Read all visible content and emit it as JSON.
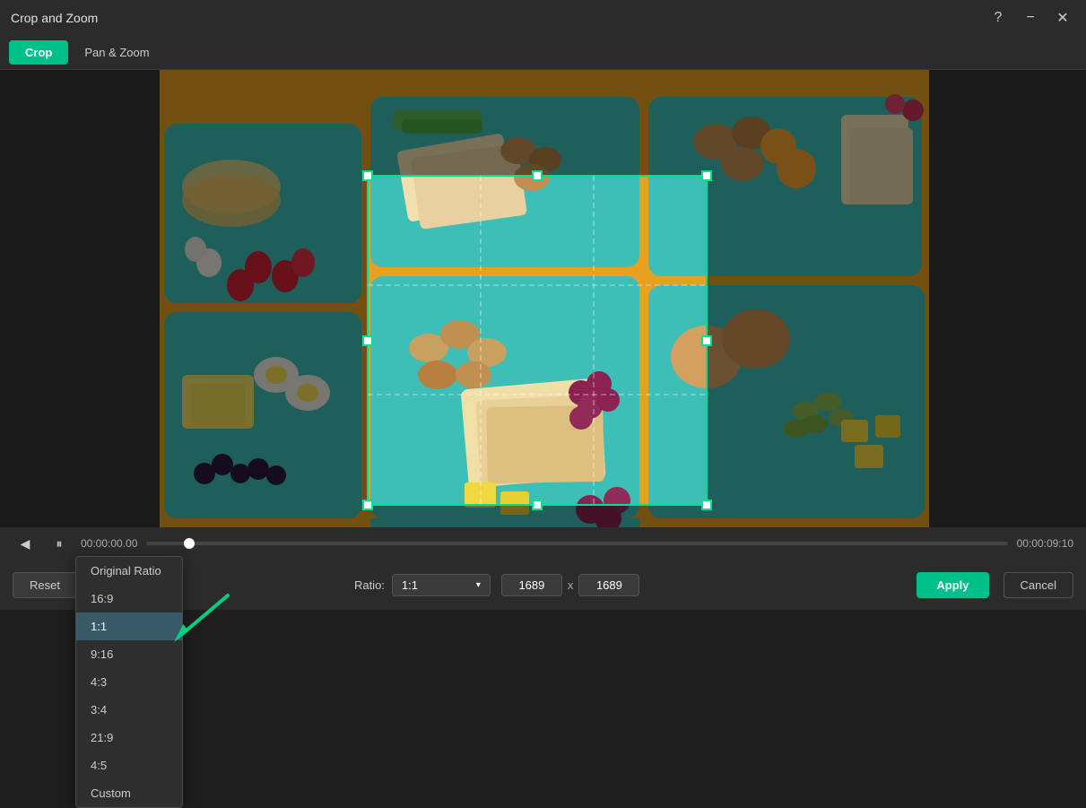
{
  "window": {
    "title": "Crop and Zoom",
    "help_icon": "?",
    "minimize_icon": "−",
    "close_icon": "✕"
  },
  "tabs": [
    {
      "id": "crop",
      "label": "Crop",
      "active": true
    },
    {
      "id": "pan-zoom",
      "label": "Pan & Zoom",
      "active": false
    }
  ],
  "dropdown": {
    "items": [
      {
        "id": "original",
        "label": "Original Ratio",
        "selected": false
      },
      {
        "id": "16:9",
        "label": "16:9",
        "selected": false
      },
      {
        "id": "1:1",
        "label": "1:1",
        "selected": true
      },
      {
        "id": "9:16",
        "label": "9:16",
        "selected": false
      },
      {
        "id": "4:3",
        "label": "4:3",
        "selected": false
      },
      {
        "id": "3:4",
        "label": "3:4",
        "selected": false
      },
      {
        "id": "21:9",
        "label": "21:9",
        "selected": false
      },
      {
        "id": "4:5",
        "label": "4:5",
        "selected": false
      },
      {
        "id": "custom",
        "label": "Custom",
        "selected": false
      }
    ]
  },
  "timeline": {
    "start_time": "00:00:00.00",
    "end_time": "00:00:09:10"
  },
  "controls": {
    "ratio_label": "Ratio:",
    "ratio_value": "1:1",
    "width": "1689",
    "height": "1689",
    "separator": "x",
    "reset_label": "Reset",
    "apply_label": "Apply",
    "cancel_label": "Cancel"
  }
}
